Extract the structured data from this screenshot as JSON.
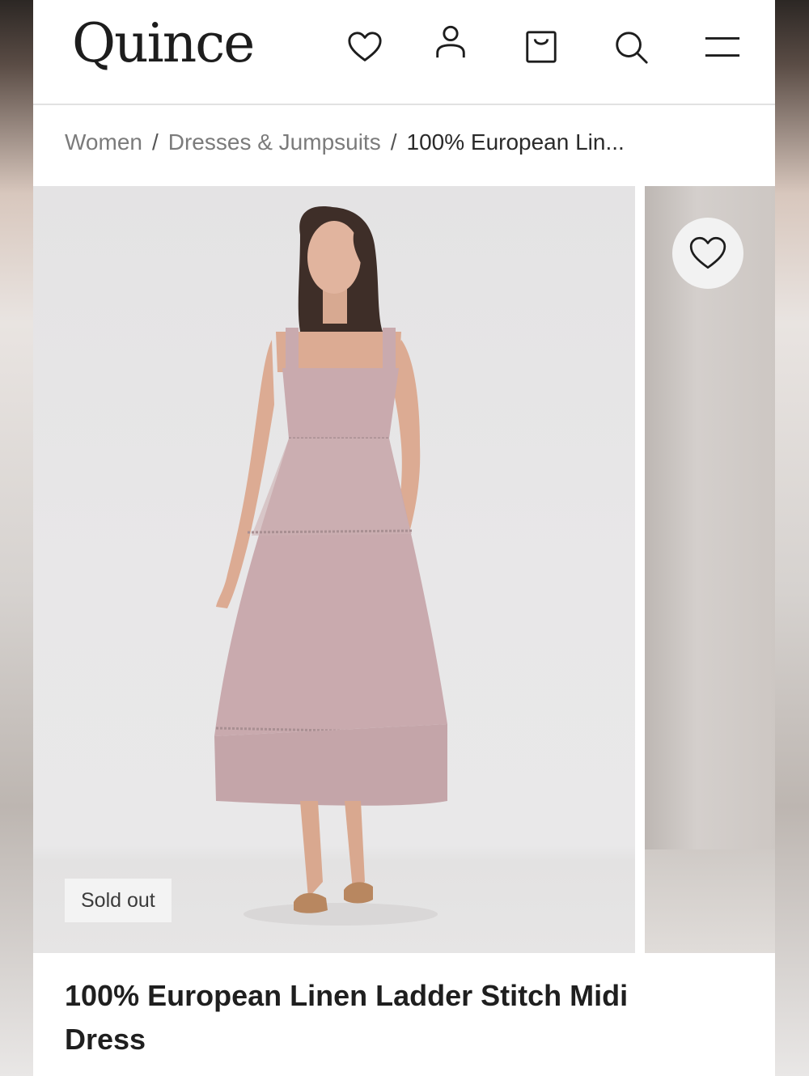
{
  "header": {
    "logo": "Quince",
    "icons": [
      "heart-icon",
      "account-icon",
      "bag-icon",
      "search-icon",
      "menu-icon"
    ]
  },
  "breadcrumb": {
    "items": [
      "Women",
      "Dresses & Jumpsuits",
      "100% European Lin..."
    ],
    "separator": "/"
  },
  "gallery": {
    "badge": "Sold out",
    "wishlist_icon": "heart-icon",
    "dress_color": "#c9aaae"
  },
  "product": {
    "title": "100% European Linen Ladder Stitch Midi Dress"
  }
}
